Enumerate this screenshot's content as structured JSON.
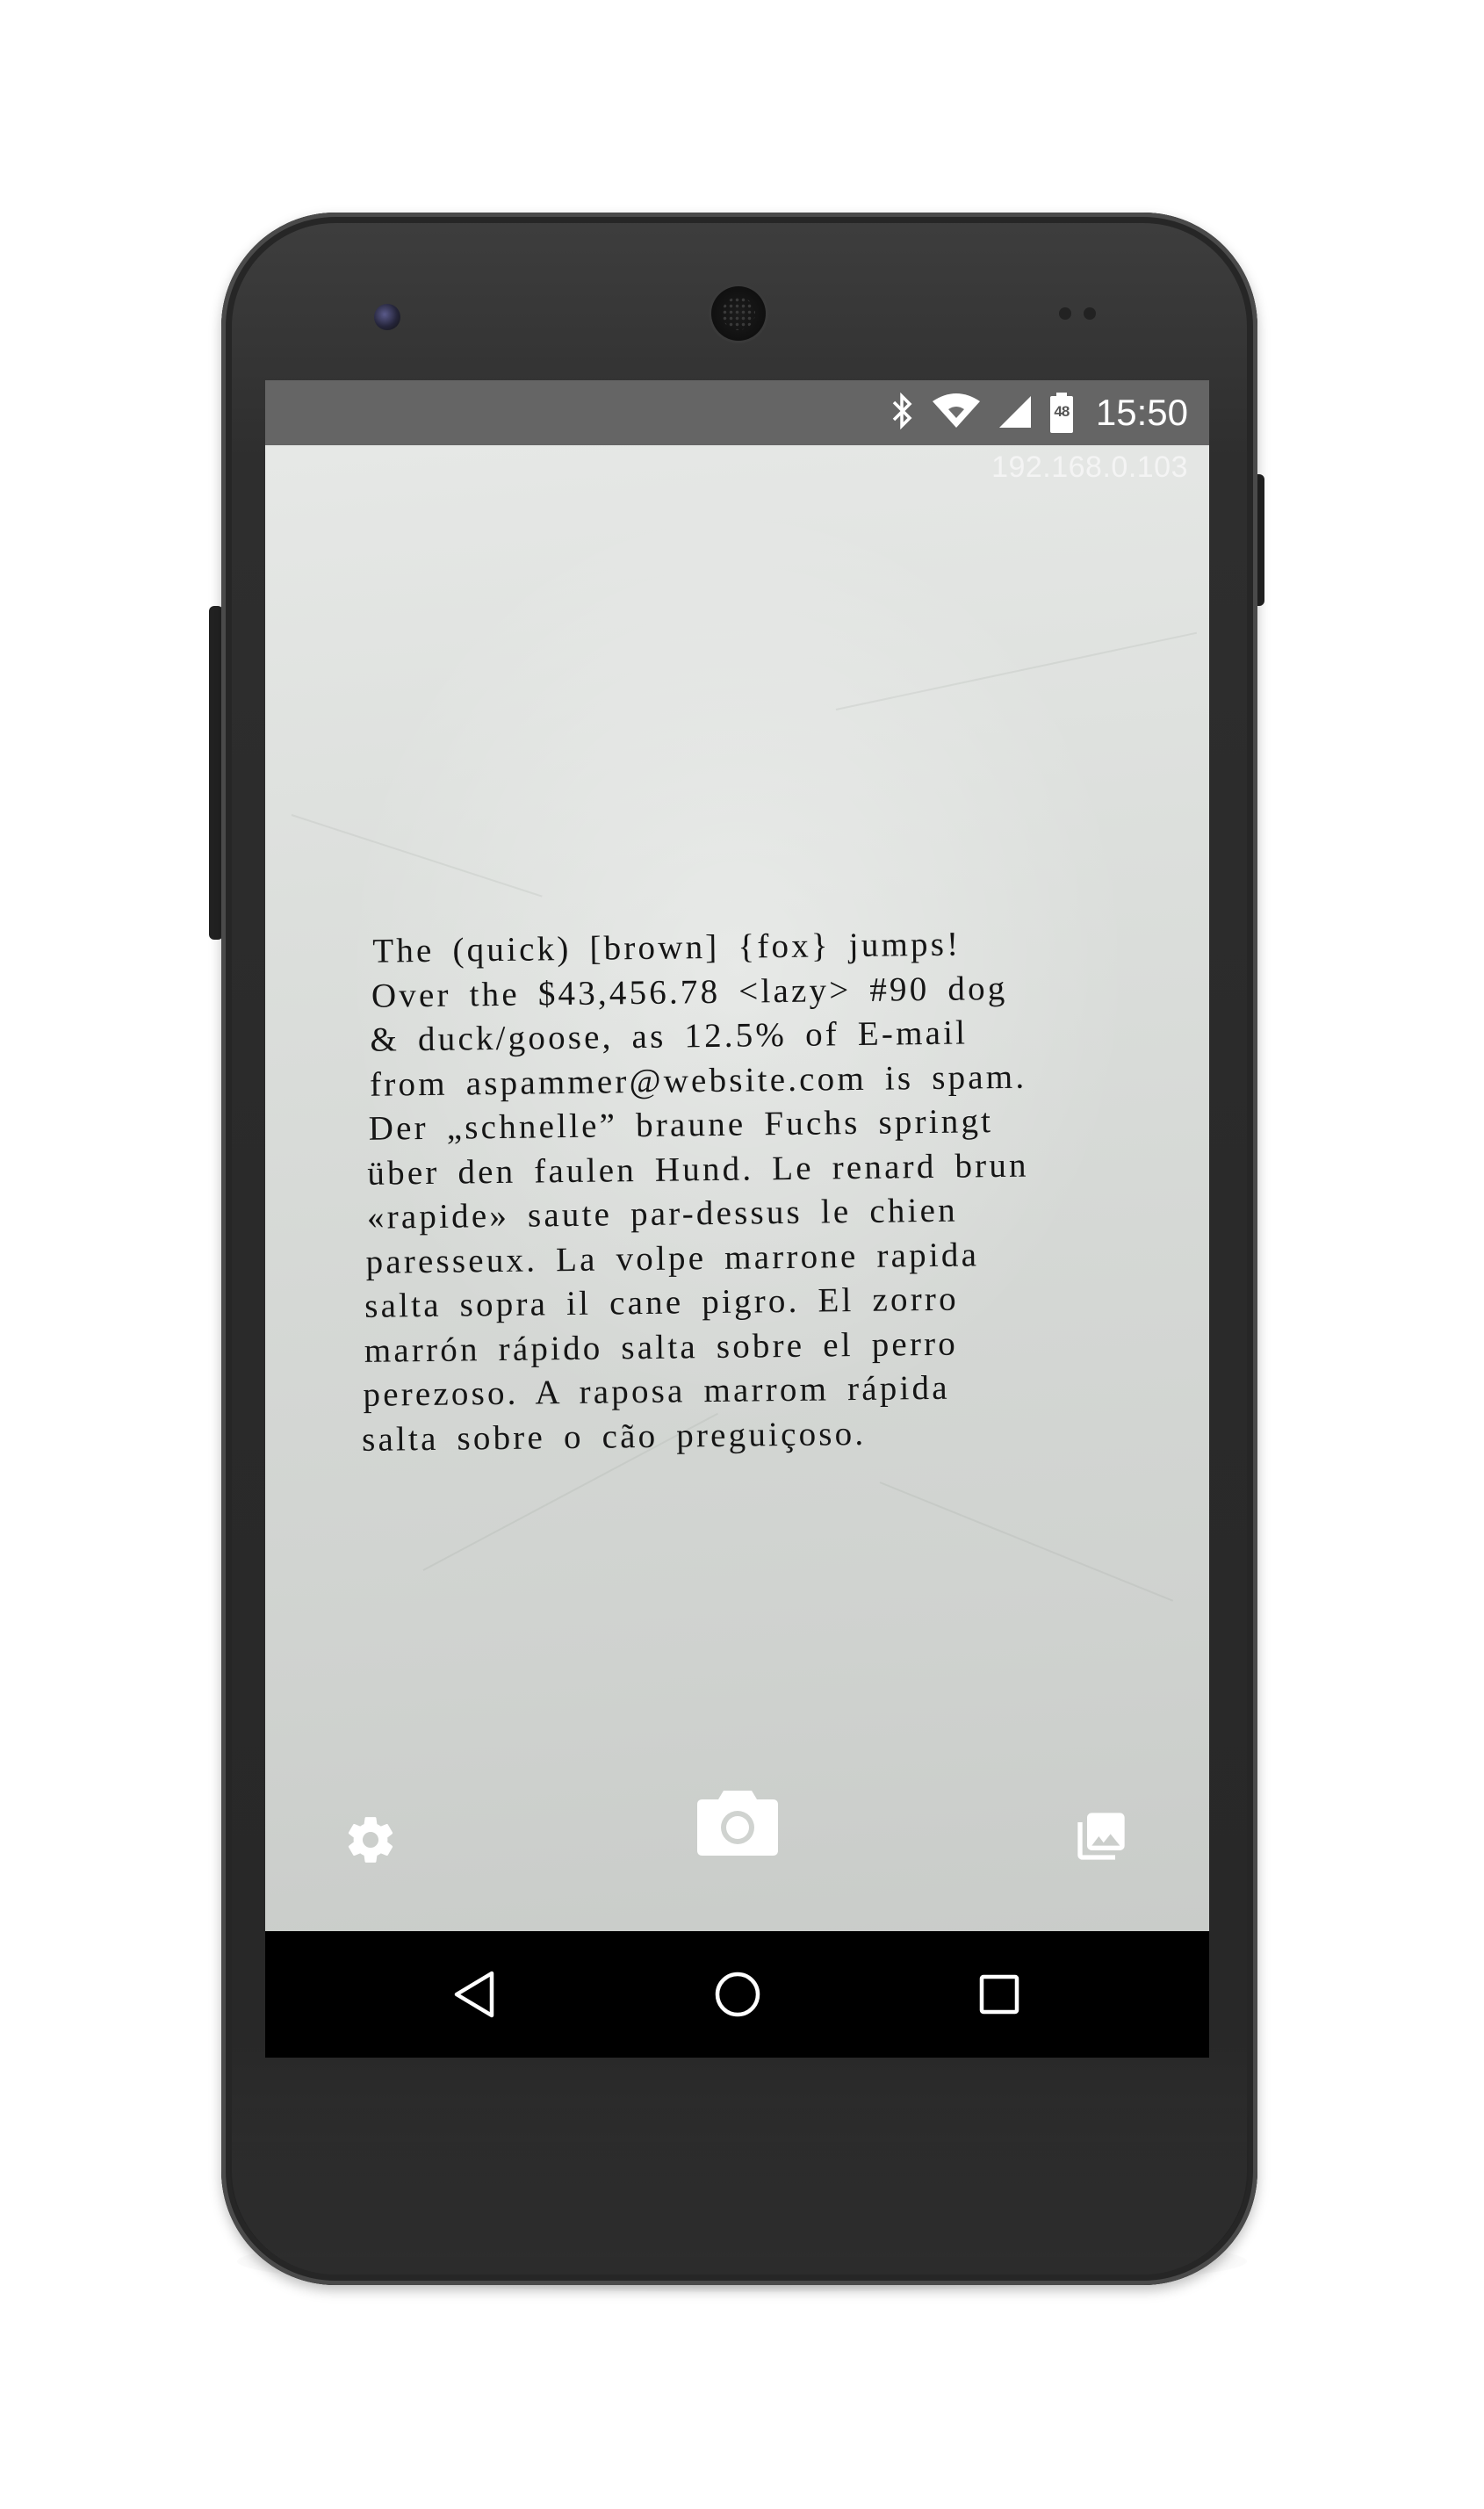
{
  "status_bar": {
    "time": "15:50",
    "battery_level": "48",
    "icons": [
      "bluetooth-icon",
      "wifi-icon",
      "cell-signal-icon",
      "battery-icon"
    ]
  },
  "overlay": {
    "ip_address": "192.168.0.103"
  },
  "document": {
    "lines": [
      "The (quick) [brown] {fox} jumps!",
      "Over the $43,456.78 <lazy> #90 dog",
      "& duck/goose, as 12.5% of E-mail",
      "from aspammer@website.com is spam.",
      "Der „schnelle” braune Fuchs springt",
      "über den faulen Hund. Le renard brun",
      "«rapide» saute par-dessus le chien",
      "paresseux. La volpe marrone rapida",
      "salta sopra il cane pigro. El zorro",
      "marrón rápido salta sobre el perro",
      "perezoso. A raposa marrom rápida",
      "salta sobre o cão preguiçoso."
    ]
  },
  "controls": {
    "icons": [
      "settings-gear-icon",
      "camera-shutter-icon",
      "gallery-icon"
    ]
  },
  "nav_bar": {
    "icons": [
      "back-icon",
      "home-icon",
      "recents-icon"
    ]
  },
  "colors": {
    "status_bar": "#6e6e6e",
    "paper": "#d8dbd8",
    "text": "#151515",
    "nav_bar": "#000000",
    "icon": "#ffffff"
  }
}
